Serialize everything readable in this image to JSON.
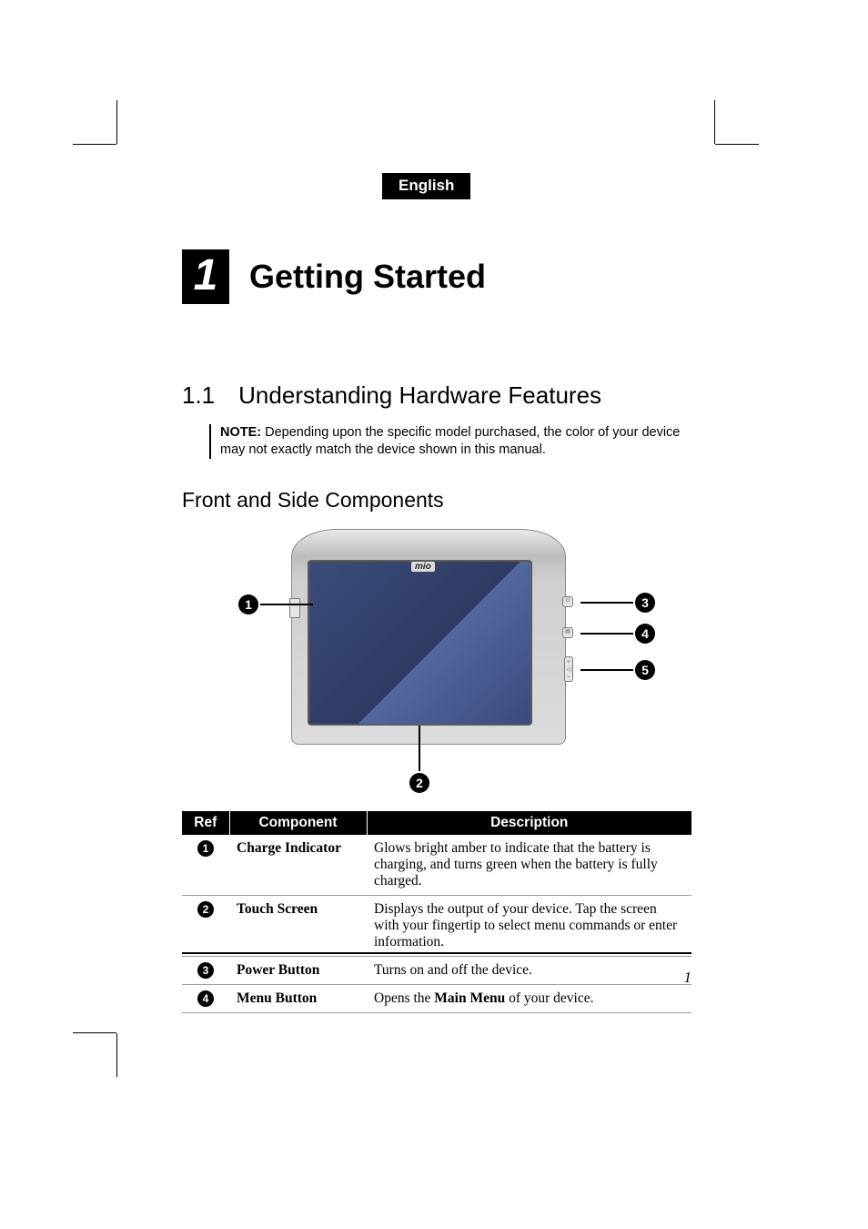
{
  "lang_badge": "English",
  "chapter": {
    "number": "1",
    "title": "Getting Started"
  },
  "section": {
    "number": "1.1",
    "title": "Understanding Hardware Features"
  },
  "note": {
    "label": "NOTE:",
    "text": " Depending upon the specific model purchased, the color of your device may not exactly match the device shown in this manual."
  },
  "subsection": "Front and Side Components",
  "device": {
    "logo": "mio",
    "side": {
      "power_glyph": "⏻",
      "menu_glyph": "▤",
      "vol_glyph": "+\n◁\n−"
    }
  },
  "callouts": {
    "c1": "1",
    "c2": "2",
    "c3": "3",
    "c4": "4",
    "c5": "5"
  },
  "table": {
    "headers": {
      "ref": "Ref",
      "component": "Component",
      "description": "Description"
    },
    "rows": [
      {
        "ref": "1",
        "component": "Charge Indicator",
        "description": "Glows bright amber to indicate that the battery is charging, and turns green when the battery is fully charged."
      },
      {
        "ref": "2",
        "component": "Touch Screen",
        "description": "Displays the output of your device. Tap the screen with your fingertip to select menu commands or enter information."
      },
      {
        "ref": "3",
        "component": "Power Button",
        "description": "Turns on and off the device."
      },
      {
        "ref": "4",
        "component": "Menu Button",
        "description_pre": "Opens the ",
        "description_bold": "Main Menu",
        "description_post": " of your device."
      }
    ]
  },
  "page_number": "1"
}
